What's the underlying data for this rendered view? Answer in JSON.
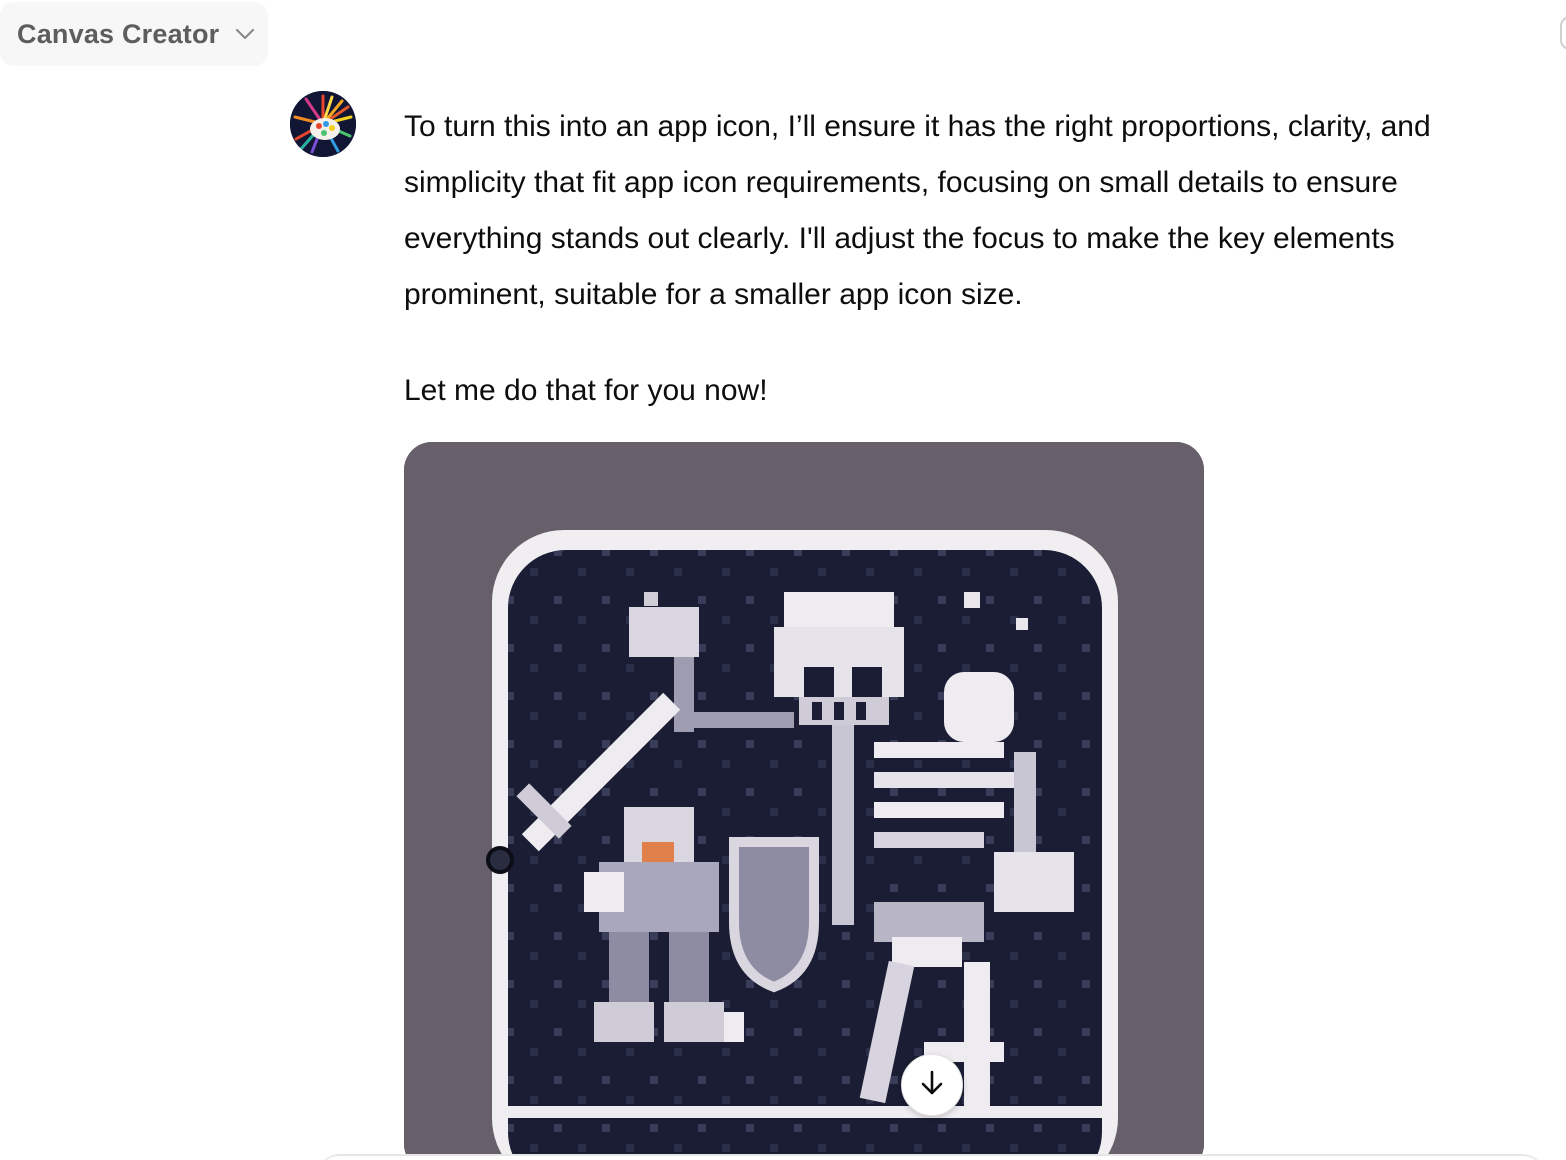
{
  "header": {
    "model_label": "Canvas Creator",
    "chevron_icon": "chevron-down-icon"
  },
  "assistant": {
    "avatar_icon": "palette-avatar-icon",
    "message": {
      "paragraph_1": "To turn this into an app icon, I’ll ensure it has the right proportions, clarity, and simplicity that fit app icon requirements, focusing on small details to ensure everything stands out clearly. I'll adjust the focus to make the key elements prominent, suitable for a smaller app icon size.",
      "paragraph_2": "Let me do that for you now!"
    },
    "generated_image": {
      "subject": "pixel-art app icon: knight with sword and shield facing a skeleton",
      "download_icon": "arrow-down-icon"
    }
  },
  "colors": {
    "icon_background": "#67606a",
    "icon_field": "#1a1d33",
    "icon_border": "#e9e6ec",
    "pixel_light": "#f1eef2",
    "pixel_mid": "#9e9cb0",
    "knight_face": "#e0814c",
    "model_label": "#5d5d5d"
  }
}
